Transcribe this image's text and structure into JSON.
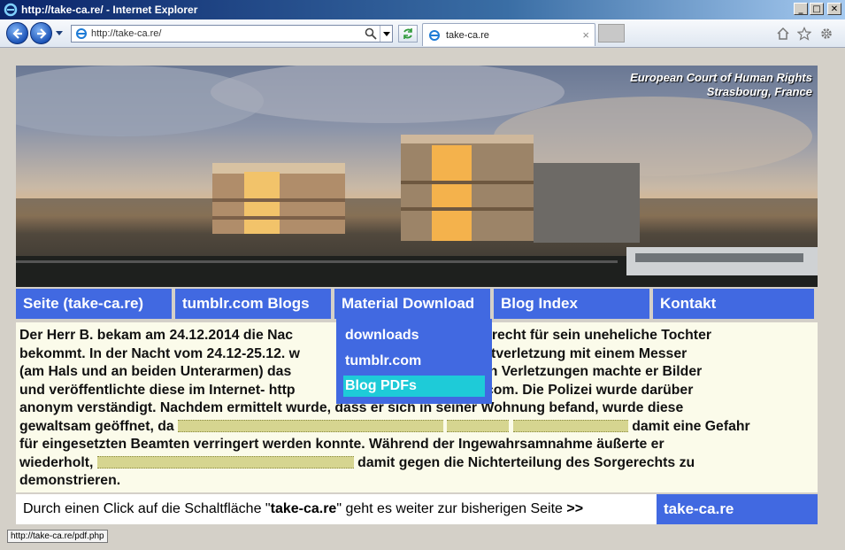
{
  "window": {
    "title": "http://take-ca.re/ - Internet Explorer",
    "minimize": "_",
    "maximize": "□",
    "close": "✕"
  },
  "toolbar": {
    "address": "http://take-ca.re/",
    "tab_label": "take-ca.re",
    "tab_close": "×",
    "icons": [
      "back-arrow-icon",
      "forward-arrow-icon",
      "search-icon",
      "refresh-icon",
      "home-icon",
      "favorites-star-icon",
      "settings-gear-icon"
    ]
  },
  "banner": {
    "caption_line1": "European Court of Human Rights",
    "caption_line2": "Strasbourg, France"
  },
  "menu": {
    "items": [
      {
        "label": "Seite (take-ca.re)"
      },
      {
        "label": "tumblr.com Blogs"
      },
      {
        "label": "Material Download"
      },
      {
        "label": "Blog Index"
      },
      {
        "label": "Kontakt"
      }
    ],
    "dropdown": [
      {
        "label": "downloads"
      },
      {
        "label": "tumblr.com"
      },
      {
        "label": "Blog PDFs"
      }
    ]
  },
  "article": {
    "lines": [
      {
        "a": "Der Herr B. bekam am 24.12.2014 die Nac",
        "b": "Sorgerecht für sein uneheliche Tochter"
      },
      {
        "a": "bekommt. In der Nacht vom 24.12-25.12. w",
        "b": "rch Selbstverletzung mit einem Messer"
      },
      {
        "a": "(am Hals und an beiden Unterarmen) das",
        "b": "Von den Verletzungen machte er Bilder"
      },
      {
        "a": "und veröffentlichte diese im Internet- http",
        "b": "umblr.com. Die Polizei wurde darüber"
      },
      {
        "a": "anonym verständigt. Nachdem ermittelt wurde, dass er sich in seiner Wohnung befand, wurde diese"
      },
      {
        "a": "gewaltsam geöffnet, da",
        "b": "damit eine Gefahr"
      },
      {
        "a": "für eingesetzten Beamten verringert werden konnte. Während der Ingewahrsamnahme äußerte er"
      },
      {
        "a": "wiederholt,",
        "b": "damit gegen die Nichterteilung des Sorgerechts zu"
      },
      {
        "a": "demonstrieren."
      }
    ]
  },
  "footer": {
    "text_before": "Durch einen Click auf die Schaltfläche \"",
    "text_bold": "take-ca.re",
    "text_after": "\" geht es weiter zur bisherigen Seite ",
    "arrows": ">>",
    "button_label": "take-ca.re"
  },
  "status": {
    "url": "http://take-ca.re/pdf.php"
  },
  "colors": {
    "menu_blue": "#4169e1",
    "dropdown_highlight": "#1ecbd8",
    "scan_bg": "#fbfbea"
  }
}
